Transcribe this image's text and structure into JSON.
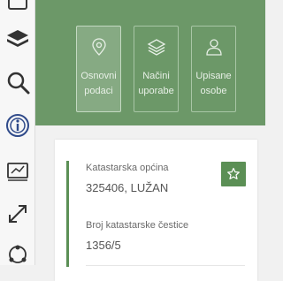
{
  "sidebar": {
    "icons": [
      "panel-icon",
      "layers-icon",
      "search-icon",
      "info-icon",
      "map-print-icon",
      "fullscreen-icon",
      "share-icon"
    ]
  },
  "tabs": [
    {
      "label": "Osnovni\npodaci",
      "icon": "map-pin-icon",
      "active": true
    },
    {
      "label": "Načini\nuporabe",
      "icon": "layers-icon",
      "active": false
    },
    {
      "label": "Upisane\nosobe",
      "icon": "person-icon",
      "active": false
    }
  ],
  "details": {
    "cadastral_municipality_label": "Katastarska općina",
    "cadastral_municipality_value": "325406, LUŽAN",
    "parcel_number_label": "Broj katastarske čestice",
    "parcel_number_value": "1356/5"
  },
  "colors": {
    "accent": "#5b8f55",
    "banner": "#6c9868"
  }
}
